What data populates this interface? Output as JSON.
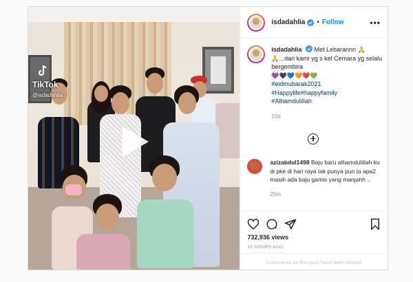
{
  "video": {
    "watermark": "TikTok",
    "watermark_handle": "@isdadahlia"
  },
  "header": {
    "username": "isdadahlia",
    "separator": "•",
    "follow_label": "Follow",
    "more_label": "•••"
  },
  "caption": {
    "username": "isdadahlia",
    "line1": "Met Lebarannn 🙏",
    "line2": "🙏...dari kami yg s kel Cemara yg selalu bergembira",
    "hearts": "💜🖤💙🧡❤️💚",
    "hashtags": [
      "#eidmubarak2021",
      "#Happylife#happyfamily",
      "#Alhamdulillah"
    ],
    "time": "15h"
  },
  "comment": {
    "username": "azizabdul1498",
    "text": "Baju baru alhamdulillah ku di pke di hari raya tak punya pun ta apa2 masih ada baju gamis yang manjahh ..",
    "time": "25m"
  },
  "stats": {
    "views": "732,936 views",
    "posted": "15 HOURS AGO"
  },
  "footer": {
    "limited_text": "Comments on this post have been limited."
  },
  "icons": {
    "like": "heart-icon",
    "comment": "comment-icon",
    "share": "paper-plane-icon",
    "save": "bookmark-icon"
  },
  "colors": {
    "link": "#0095f6",
    "hashtag": "#00376b",
    "muted": "#8e8e8e"
  }
}
